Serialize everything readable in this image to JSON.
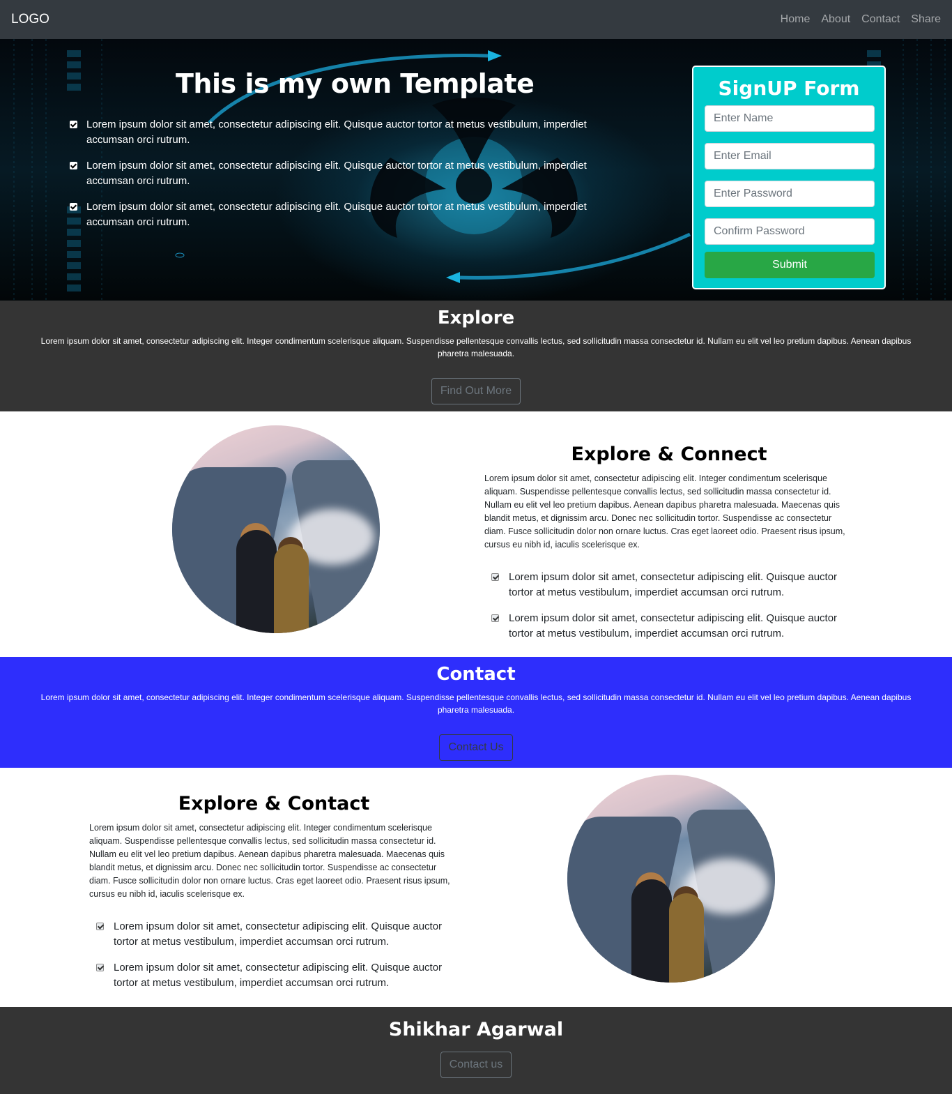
{
  "navbar": {
    "logo": "LOGO",
    "links": [
      "Home",
      "About",
      "Contact",
      "Share"
    ]
  },
  "hero": {
    "title": "This is my own Template",
    "bullets": [
      "Lorem ipsum dolor sit amet, consectetur adipiscing elit. Quisque auctor tortor at metus vestibulum, imperdiet accumsan orci rutrum.",
      "Lorem ipsum dolor sit amet, consectetur adipiscing elit. Quisque auctor tortor at metus vestibulum, imperdiet accumsan orci rutrum.",
      "Lorem ipsum dolor sit amet, consectetur adipiscing elit. Quisque auctor tortor at metus vestibulum, imperdiet accumsan orci rutrum."
    ]
  },
  "signup": {
    "title": "SignUP Form",
    "name_placeholder": "Enter Name",
    "email_placeholder": "Enter Email",
    "password_placeholder": "Enter Password",
    "confirm_placeholder": "Confirm Password",
    "submit_label": "Submit"
  },
  "explore": {
    "title": "Explore",
    "text": "Lorem ipsum dolor sit amet, consectetur adipiscing elit. Integer condimentum scelerisque aliquam. Suspendisse pellentesque convallis lectus, sed sollicitudin massa consectetur id. Nullam eu elit vel leo pretium dapibus. Aenean dapibus pharetra malesuada.",
    "button": "Find Out More"
  },
  "connect": {
    "title": "Explore & Connect",
    "text": "Lorem ipsum dolor sit amet, consectetur adipiscing elit. Integer condimentum scelerisque aliquam. Suspendisse pellentesque convallis lectus, sed sollicitudin massa consectetur id. Nullam eu elit vel leo pretium dapibus. Aenean dapibus pharetra malesuada. Maecenas quis blandit metus, et dignissim arcu. Donec nec sollicitudin tortor. Suspendisse ac consectetur diam. Fusce sollicitudin dolor non ornare luctus. Cras eget laoreet odio. Praesent risus ipsum, cursus eu nibh id, iaculis scelerisque ex.",
    "bullets": [
      "Lorem ipsum dolor sit amet, consectetur adipiscing elit. Quisque auctor tortor at metus vestibulum, imperdiet accumsan orci rutrum.",
      "Lorem ipsum dolor sit amet, consectetur adipiscing elit. Quisque auctor tortor at metus vestibulum, imperdiet accumsan orci rutrum."
    ]
  },
  "contact": {
    "title": "Contact",
    "text": "Lorem ipsum dolor sit amet, consectetur adipiscing elit. Integer condimentum scelerisque aliquam. Suspendisse pellentesque convallis lectus, sed sollicitudin massa consectetur id. Nullam eu elit vel leo pretium dapibus. Aenean dapibus pharetra malesuada.",
    "button": "Contact Us"
  },
  "explore_contact": {
    "title": "Explore & Contact",
    "text": "Lorem ipsum dolor sit amet, consectetur adipiscing elit. Integer condimentum scelerisque aliquam. Suspendisse pellentesque convallis lectus, sed sollicitudin massa consectetur id. Nullam eu elit vel leo pretium dapibus. Aenean dapibus pharetra malesuada. Maecenas quis blandit metus, et dignissim arcu. Donec nec sollicitudin tortor. Suspendisse ac consectetur diam. Fusce sollicitudin dolor non ornare luctus. Cras eget laoreet odio. Praesent risus ipsum, cursus eu nibh id, iaculis scelerisque ex.",
    "bullets": [
      "Lorem ipsum dolor sit amet, consectetur adipiscing elit. Quisque auctor tortor at metus vestibulum, imperdiet accumsan orci rutrum.",
      "Lorem ipsum dolor sit amet, consectetur adipiscing elit. Quisque auctor tortor at metus vestibulum, imperdiet accumsan orci rutrum."
    ]
  },
  "footer": {
    "name": "Shikhar Agarwal",
    "button": "Contact us"
  },
  "colors": {
    "navbar": "#343a40",
    "signup_panel": "#00cccc",
    "submit": "#28a745",
    "dark_band": "#343434",
    "contact_band": "#2e2efc"
  },
  "icons": [
    "checkbox-checked-icon",
    "hero-biohazard-graphic",
    "landscape-photo"
  ]
}
